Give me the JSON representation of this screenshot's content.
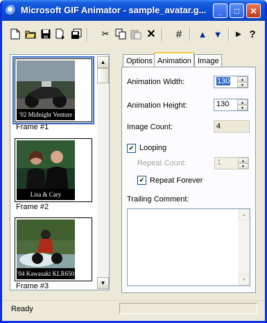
{
  "window": {
    "title": "Microsoft GIF Animator - sample_avatar.g...",
    "controls": {
      "minimize": "_",
      "maximize": "□",
      "close": "✕"
    }
  },
  "toolbar": {
    "buttons": [
      {
        "name": "new",
        "icon": "new-document-icon"
      },
      {
        "name": "open",
        "icon": "open-folder-icon"
      },
      {
        "name": "save",
        "icon": "floppy-disk-icon"
      },
      {
        "name": "insert",
        "icon": "insert-file-icon"
      },
      {
        "name": "save-as",
        "icon": "save-as-icon"
      },
      {
        "name": "cut",
        "icon": "scissors-icon",
        "glyph": "✂"
      },
      {
        "name": "copy",
        "icon": "copy-icon"
      },
      {
        "name": "paste",
        "icon": "paste-icon"
      },
      {
        "name": "delete",
        "icon": "delete-x-icon",
        "glyph": "✕"
      },
      {
        "name": "select-all",
        "icon": "select-all-grid-icon",
        "glyph": "#"
      },
      {
        "name": "move-up",
        "icon": "arrow-up-icon",
        "glyph": "▲"
      },
      {
        "name": "move-down",
        "icon": "arrow-down-icon",
        "glyph": "▼"
      },
      {
        "name": "preview",
        "icon": "play-icon",
        "glyph": "▶"
      },
      {
        "name": "help",
        "icon": "help-question-icon",
        "glyph": "?"
      }
    ]
  },
  "frames": [
    {
      "label": "Frame #1",
      "caption": "'02 Midnight Venture",
      "selected": true
    },
    {
      "label": "Frame #2",
      "caption": "Lisa & Cary",
      "selected": false
    },
    {
      "label": "Frame #3",
      "caption": "'04 Kawasaki KLR650",
      "selected": false
    }
  ],
  "tabs": [
    {
      "label": "Options",
      "active": false
    },
    {
      "label": "Animation",
      "active": true
    },
    {
      "label": "Image",
      "active": false
    }
  ],
  "animation": {
    "width_label": "Animation Width:",
    "width_value": "130",
    "height_label": "Animation Height:",
    "height_value": "130",
    "image_count_label": "Image Count:",
    "image_count_value": "4",
    "looping_label": "Looping",
    "looping_checked": true,
    "repeat_count_label": "Repeat Count:",
    "repeat_count_value": "1",
    "repeat_forever_label": "Repeat Forever",
    "repeat_forever_checked": true,
    "trailing_comment_label": "Trailing Comment:",
    "trailing_comment_value": ""
  },
  "status": {
    "text": "Ready"
  },
  "colors": {
    "titlebar": "#0a4fd6",
    "selection": "#316ac5",
    "face": "#ece9d8"
  }
}
